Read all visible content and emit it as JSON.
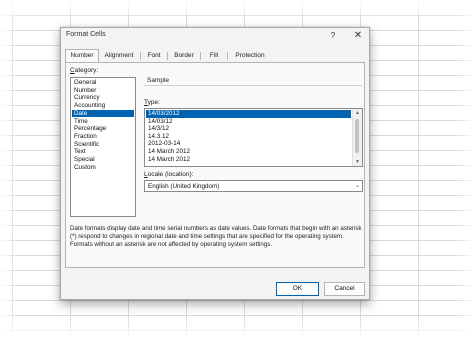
{
  "dialog": {
    "title": "Format Cells",
    "help_label": "?",
    "close_label": "✕"
  },
  "tabs": [
    {
      "label": "Number",
      "active": true
    },
    {
      "label": "Alignment",
      "active": false
    },
    {
      "label": "Font",
      "active": false
    },
    {
      "label": "Border",
      "active": false
    },
    {
      "label": "Fill",
      "active": false
    },
    {
      "label": "Protection",
      "active": false
    }
  ],
  "category": {
    "label_first": "C",
    "label_rest": "ategory:",
    "items": [
      "General",
      "Number",
      "Currency",
      "Accounting",
      "Date",
      "Time",
      "Percentage",
      "Fraction",
      "Scientific",
      "Text",
      "Special",
      "Custom"
    ],
    "selected": "Date"
  },
  "sample": {
    "label": "Sample",
    "value": ""
  },
  "type": {
    "label_first": "T",
    "label_rest": "ype:",
    "items": [
      "14/03/2012",
      "14/03/12",
      "14/3/12",
      "14.3.12",
      "2012-03-14",
      "14 March 2012",
      "14 March 2012"
    ],
    "selected": "14/03/2012",
    "scroll_up": "▲",
    "scroll_down": "▼"
  },
  "locale": {
    "label_first": "L",
    "label_rest": "ocale (location):",
    "value": "English (United Kingdom)",
    "chevron": "⌄"
  },
  "description": "Date formats display date and time serial numbers as date values.  Date formats that begin with an asterisk (*) respond to changes in regional date and time settings that are specified for the operating system. Formats without an asterisk are not affected by operating system settings.",
  "buttons": {
    "ok": "OK",
    "cancel": "Cancel"
  },
  "colors": {
    "selection": "#0063b1",
    "dialog_bg": "#f3f3f3"
  }
}
